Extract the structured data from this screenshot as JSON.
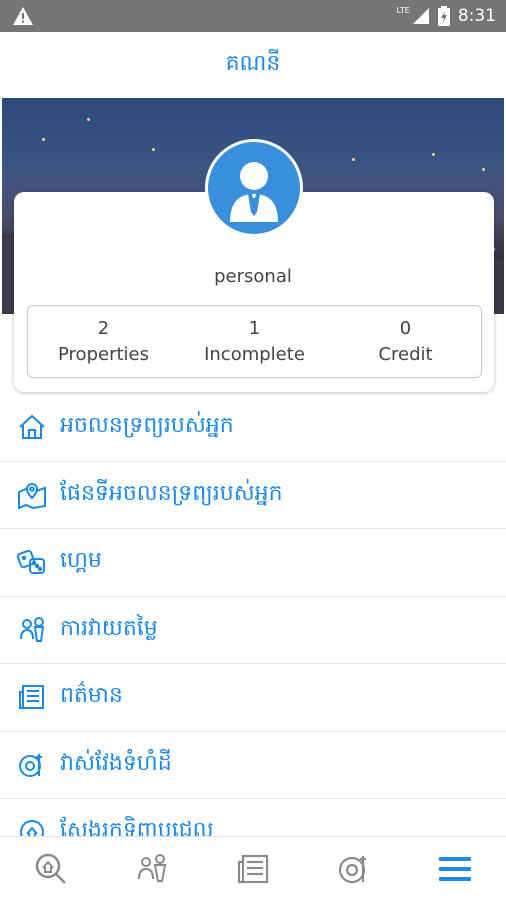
{
  "status_bar": {
    "time": "8:31",
    "network": "LTE"
  },
  "app_bar": {
    "title": "គណនី"
  },
  "profile": {
    "username": "personal",
    "stats": [
      {
        "value": "2",
        "label": "Properties"
      },
      {
        "value": "1",
        "label": "Incomplete"
      },
      {
        "value": "0",
        "label": "Credit"
      }
    ]
  },
  "menu": {
    "items": [
      {
        "label": "អចលនទ្រព្យរបស់អ្នក",
        "icon": "home-icon"
      },
      {
        "label": "ផែនទីអចលនទ្រព្យរបស់អ្នក",
        "icon": "map-pin-icon"
      },
      {
        "label": "ហ្គេម",
        "icon": "dice-icon"
      },
      {
        "label": "ការវាយតម្លៃ",
        "icon": "appraisal-icon"
      },
      {
        "label": "ពត៌មាន",
        "icon": "newspaper-icon"
      },
      {
        "label": "វាស់វែងទំហំដី",
        "icon": "measure-icon"
      },
      {
        "label": "ស្វែងរកទិញបជេល",
        "icon": "search-property-icon"
      }
    ]
  },
  "bottom_nav": {
    "items": [
      "search-tab",
      "appraisal-tab",
      "news-tab",
      "measure-tab",
      "menu-tab"
    ]
  },
  "colors": {
    "accent": "#1e88e5",
    "status_bar": "#757575",
    "avatar_bg": "#3a8fdc"
  }
}
